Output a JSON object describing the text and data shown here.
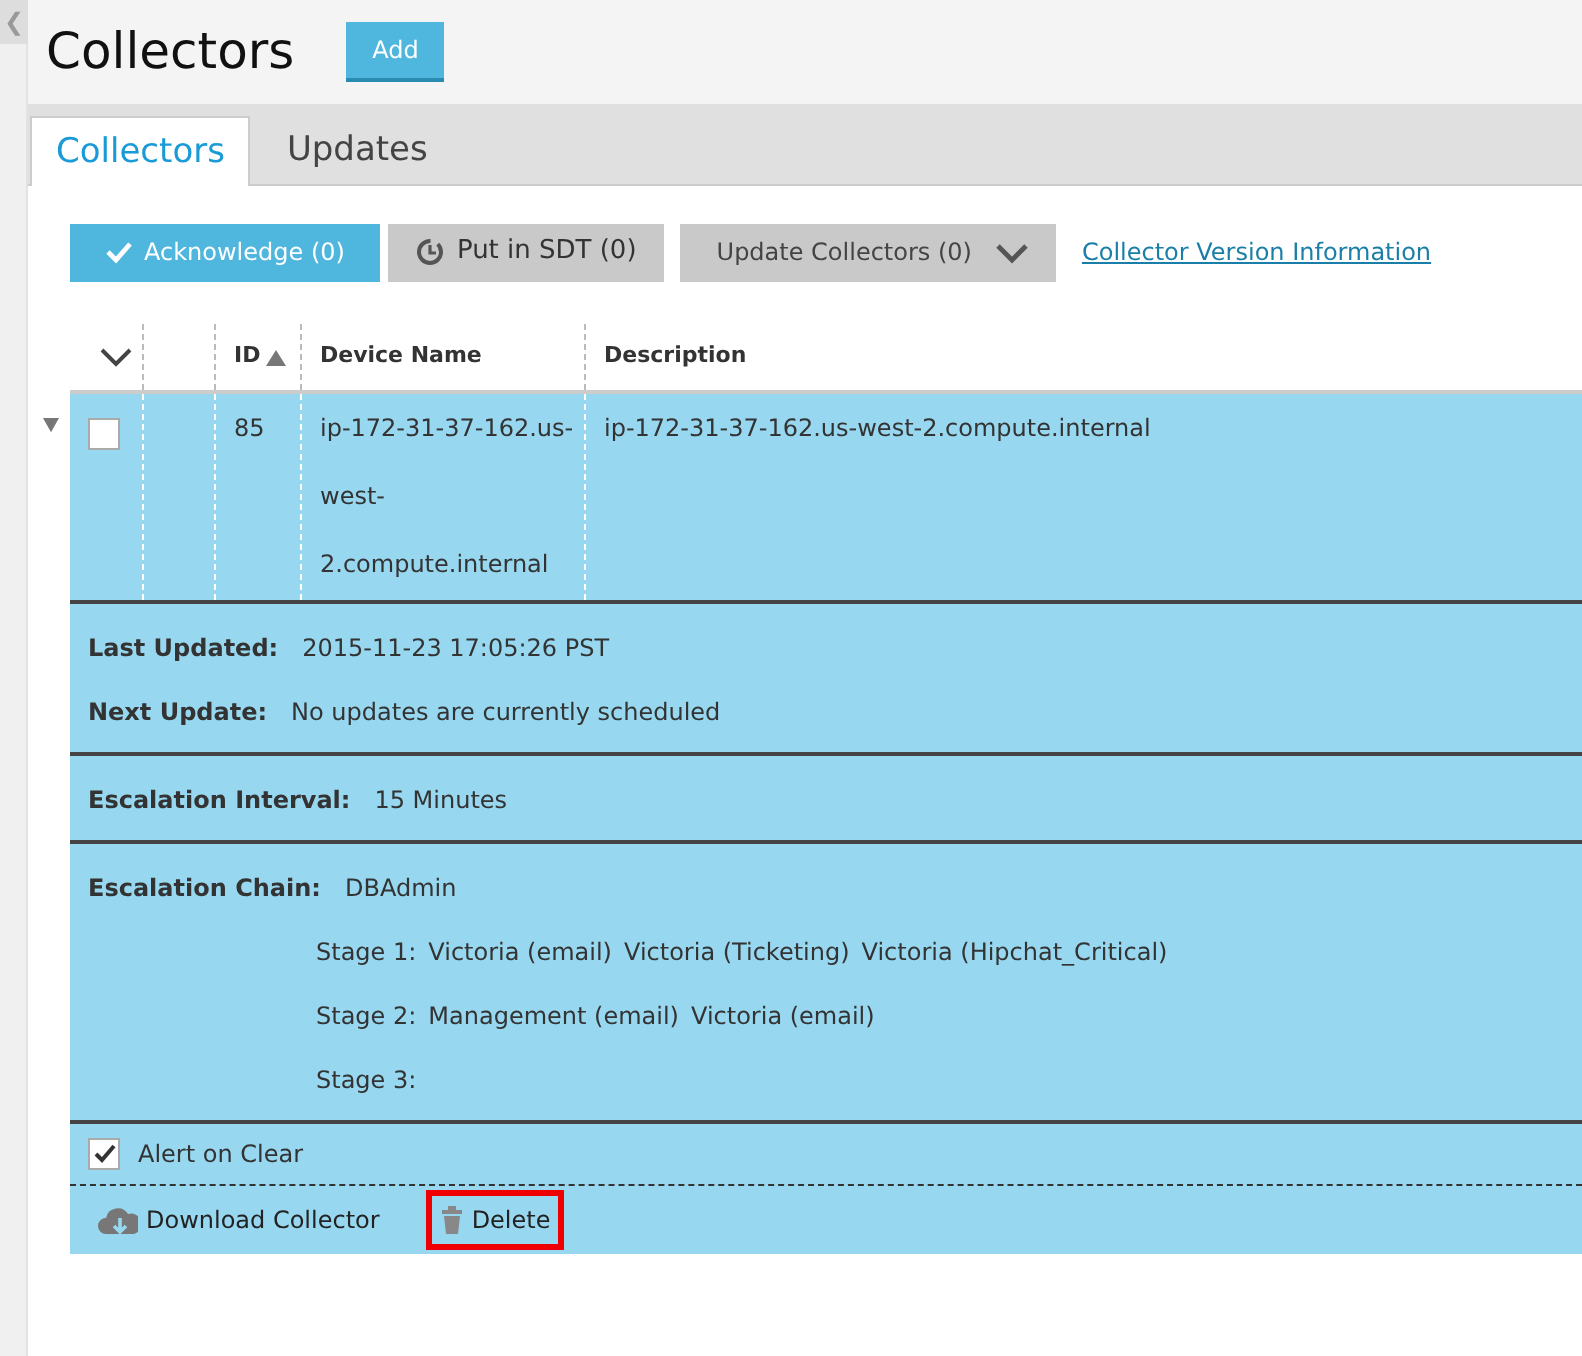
{
  "sidebar_toggle": "❮",
  "page": {
    "title": "Collectors",
    "add_button": "Add"
  },
  "tabs": [
    {
      "label": "Collectors",
      "selected": true
    },
    {
      "label": "Updates",
      "selected": false
    }
  ],
  "toolbar": [
    {
      "kind": "acknowledge",
      "label": "Acknowledge (0)"
    },
    {
      "kind": "sdt",
      "label": "Put in SDT (0)"
    },
    {
      "kind": "dropdown",
      "label": "Update Collectors (0)"
    },
    {
      "kind": "link",
      "label": "Collector Version Information"
    }
  ],
  "table": {
    "columns": [
      {
        "kind": "toggle"
      },
      {
        "kind": "blank"
      },
      {
        "kind": "id",
        "label": "ID",
        "sorted": true
      },
      {
        "kind": "name",
        "label": "Device Name"
      },
      {
        "kind": "desc",
        "label": "Description"
      }
    ],
    "rows": [
      {
        "expanded": true,
        "checked": false,
        "id": "85",
        "device_name": [
          "ip-172-31-37-162.us-",
          "west-",
          "2.compute.internal"
        ],
        "description": "ip-172-31-37-162.us-west-2.compute.internal",
        "details": [
          [
            {
              "label": "Last Updated:",
              "values": [
                "2015-11-23 17:05:26 PST"
              ]
            },
            {
              "label": "Next Update:",
              "values": [
                "No updates are currently scheduled"
              ]
            }
          ],
          [
            {
              "label": "Escalation Interval:",
              "values": [
                "15 Minutes"
              ]
            }
          ],
          [
            {
              "label": "Escalation Chain:",
              "values": [
                "DBAdmin"
              ],
              "stages": [
                {
                  "label": "Stage 1:",
                  "recipients": [
                    "Victoria (email)",
                    "Victoria (Ticketing)",
                    "Victoria (Hipchat_Critical)"
                  ]
                },
                {
                  "label": "Stage 2:",
                  "recipients": [
                    "Management (email)",
                    "Victoria (email)"
                  ]
                },
                {
                  "label": "Stage 3:"
                }
              ]
            }
          ]
        ],
        "alert_on_clear": {
          "label": "Alert on Clear",
          "checked": true
        },
        "actions": [
          {
            "kind": "download",
            "label": "Download Collector",
            "highlighted": false
          },
          {
            "kind": "delete",
            "label": "Delete",
            "highlighted": true
          }
        ]
      }
    ]
  }
}
